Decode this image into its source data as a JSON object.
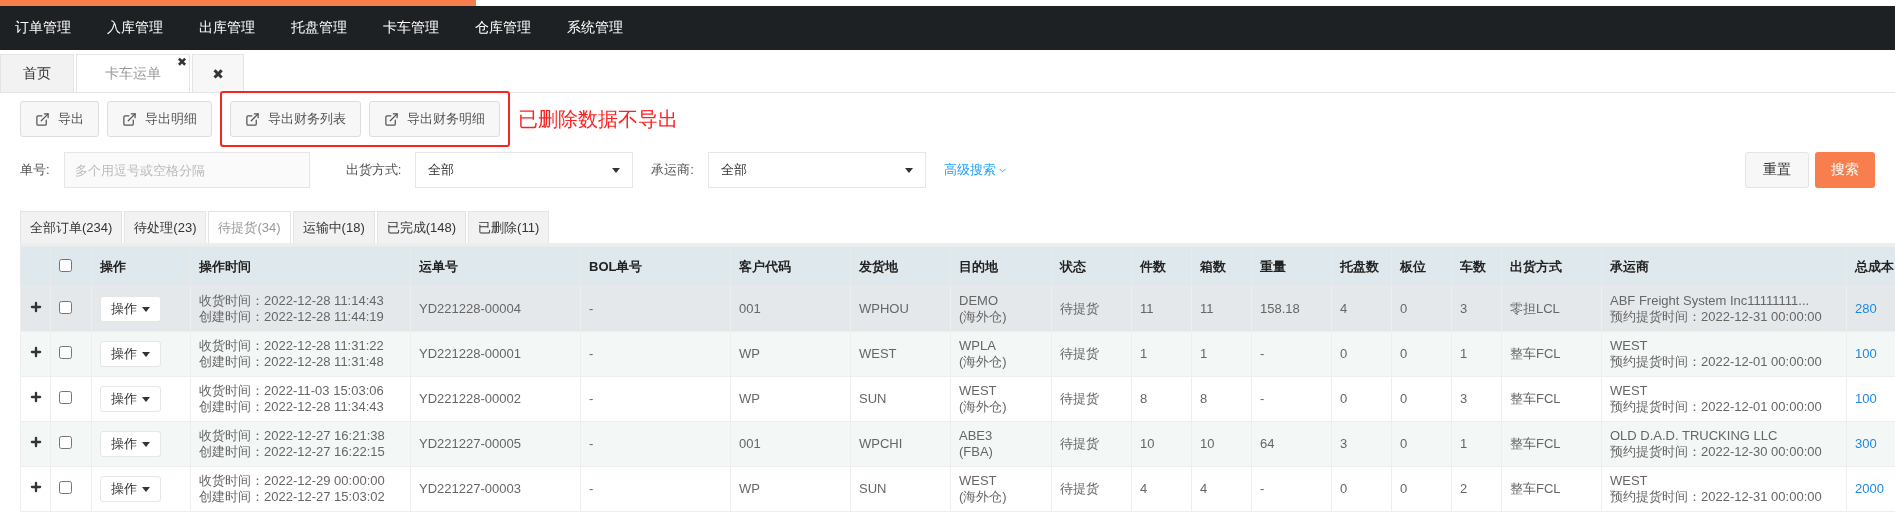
{
  "nav": [
    "订单管理",
    "入库管理",
    "出库管理",
    "托盘管理",
    "卡车管理",
    "仓库管理",
    "系统管理"
  ],
  "page_tabs": [
    {
      "label": "首页",
      "selected": false
    },
    {
      "label": "卡车运单",
      "selected": true,
      "close": "✖"
    }
  ],
  "close_all": "✖",
  "toolbar": {
    "buttons": [
      "导出",
      "导出明细"
    ],
    "finance_buttons": [
      "导出财务列表",
      "导出财务明细"
    ],
    "annotation": "已删除数据不导出"
  },
  "filters": {
    "order_label": "单号:",
    "order_placeholder": "多个用逗号或空格分隔",
    "ship_label": "出货方式:",
    "ship_value": "全部",
    "carrier_label": "承运商:",
    "carrier_value": "全部",
    "advanced": "高级搜索",
    "reset": "重置",
    "search": "搜索"
  },
  "status_tabs": [
    {
      "label": "全部订单(234)",
      "selected": false
    },
    {
      "label": "待处理(23)",
      "selected": false
    },
    {
      "label": "待提货(34)",
      "selected": true
    },
    {
      "label": "运输中(18)",
      "selected": false
    },
    {
      "label": "已完成(148)",
      "selected": false
    },
    {
      "label": "已删除(11)",
      "selected": false
    }
  ],
  "table": {
    "columns": [
      "操作",
      "操作时间",
      "运单号",
      "BOL单号",
      "客户代码",
      "发货地",
      "目的地",
      "状态",
      "件数",
      "箱数",
      "重量",
      "托盘数",
      "板位",
      "车数",
      "出货方式",
      "承运商",
      "总成本"
    ],
    "all_checked": false,
    "rows": [
      {
        "hovered": true,
        "checked": false,
        "action": "操作",
        "received": "收货时间：2022-12-28 11:14:43",
        "created": "创建时间：2022-12-28 11:44:19",
        "waybill": "YD221228-00004",
        "bol": "-",
        "customer": "001",
        "origin": "WPHOU",
        "dest": "DEMO",
        "dest_type": "(海外仓)",
        "status": "待提货",
        "pieces": "11",
        "boxes": "11",
        "weight": "158.18",
        "pallets": "4",
        "slots": "0",
        "trucks": "3",
        "ship": "零担LCL",
        "carrier": "ABF Freight System Inc11111111...",
        "pickup": "预约提货时间：2022-12-31 00:00:00",
        "cost": "280"
      },
      {
        "hovered": false,
        "checked": false,
        "action": "操作",
        "received": "收货时间：2022-12-28 11:31:22",
        "created": "创建时间：2022-12-28 11:31:48",
        "waybill": "YD221228-00001",
        "bol": "-",
        "customer": "WP",
        "origin": "WEST",
        "dest": "WPLA",
        "dest_type": "(海外仓)",
        "status": "待提货",
        "pieces": "1",
        "boxes": "1",
        "weight": "-",
        "pallets": "0",
        "slots": "0",
        "trucks": "1",
        "ship": "整车FCL",
        "carrier": "WEST",
        "pickup": "预约提货时间：2022-12-01 00:00:00",
        "cost": "100"
      },
      {
        "hovered": false,
        "checked": false,
        "action": "操作",
        "received": "收货时间：2022-11-03 15:03:06",
        "created": "创建时间：2022-12-28 11:34:43",
        "waybill": "YD221228-00002",
        "bol": "-",
        "customer": "WP",
        "origin": "SUN",
        "dest": "WEST",
        "dest_type": "(海外仓)",
        "status": "待提货",
        "pieces": "8",
        "boxes": "8",
        "weight": "-",
        "pallets": "0",
        "slots": "0",
        "trucks": "3",
        "ship": "整车FCL",
        "carrier": "WEST",
        "pickup": "预约提货时间：2022-12-01 00:00:00",
        "cost": "100"
      },
      {
        "hovered": false,
        "checked": false,
        "action": "操作",
        "received": "收货时间：2022-12-27 16:21:38",
        "created": "创建时间：2022-12-27 16:22:15",
        "waybill": "YD221227-00005",
        "bol": "-",
        "customer": "001",
        "origin": "WPCHI",
        "dest": "ABE3",
        "dest_type": "(FBA)",
        "status": "待提货",
        "pieces": "10",
        "boxes": "10",
        "weight": "64",
        "pallets": "3",
        "slots": "0",
        "trucks": "1",
        "ship": "整车FCL",
        "carrier": "OLD D.A.D. TRUCKING LLC",
        "pickup": "预约提货时间：2022-12-30 00:00:00",
        "cost": "300"
      },
      {
        "hovered": false,
        "checked": false,
        "action": "操作",
        "received": "收货时间：2022-12-29 00:00:00",
        "created": "创建时间：2022-12-27 15:03:02",
        "waybill": "YD221227-00003",
        "bol": "-",
        "customer": "WP",
        "origin": "SUN",
        "dest": "WEST",
        "dest_type": "(海外仓)",
        "status": "待提货",
        "pieces": "4",
        "boxes": "4",
        "weight": "-",
        "pallets": "0",
        "slots": "0",
        "trucks": "2",
        "ship": "整车FCL",
        "carrier": "WEST",
        "pickup": "预约提货时间：2022-12-31 00:00:00",
        "cost": "2000"
      }
    ]
  }
}
